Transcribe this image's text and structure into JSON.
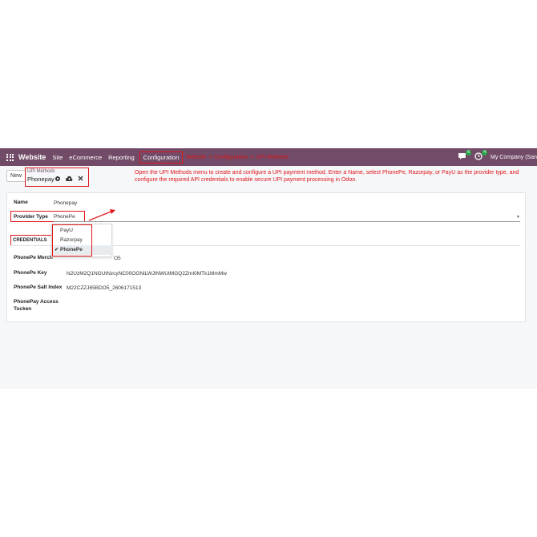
{
  "navbar": {
    "brand": "Website",
    "menu": [
      "Site",
      "eCommerce",
      "Reporting"
    ],
    "active_menu": "Configuration",
    "annotation": "Website -> Configuration -> UPI Methods",
    "chat_count": "6",
    "activity_count": "4",
    "company": "My Company (San"
  },
  "control": {
    "new_label": "New",
    "breadcrumb_parent": "UPI Methods",
    "breadcrumb_current": "Phonepay",
    "instruction": "Open the UPI Methods menu to create and configure a UPI payment method. Enter a Name, select PhonePe, Razorpay, or PayU as the provider type, and configure the required API credentials to enable secure UPI payment processing in Odoo."
  },
  "form": {
    "name_label": "Name",
    "name_value": "Phonepay",
    "provider_label": "Provider Type",
    "provider_value": "PhonePe",
    "credentials_tab": "CREDENTIALS",
    "merchant_label": "PhonePe Merch",
    "merchant_value_visible": "O5",
    "key_label": "PhonePe Key",
    "key_value": "N2UzM2Q1NGUtNzcyNC00OGNiLWJlNWUtMGQ2ZmI0MTk1MmMw",
    "salt_label": "PhonePe Salt Index",
    "salt_value": "M22CZZJ65BDO5_2606171513",
    "token_label_1": "PhonePay Access",
    "token_label_2": "Tocken"
  },
  "dropdown": {
    "options": [
      "PayU",
      "Razorpay",
      "PhonePe"
    ],
    "selected": "PhonePe"
  },
  "colors": {
    "navbar": "#714b67",
    "annotation_red": "#e0161b",
    "badge_green": "#28a745"
  }
}
